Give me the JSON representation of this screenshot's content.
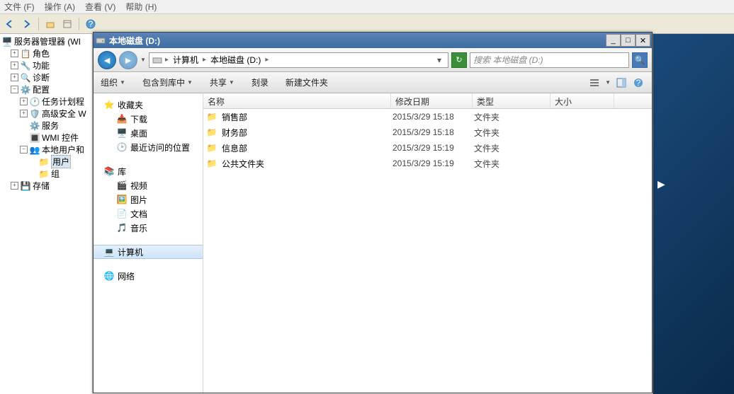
{
  "menubar": {
    "file": "文件 (F)",
    "action": "操作 (A)",
    "view": "查看 (V)",
    "help": "帮助 (H)"
  },
  "tree": {
    "root": "服务器管理器 (WI",
    "roles": "角色",
    "features": "功能",
    "diagnostics": "诊断",
    "config": "配置",
    "tasksched": "任务计划程",
    "advsec": "高级安全 W",
    "services": "服务",
    "wmi": "WMI 控件",
    "localusers": "本地用户和",
    "users": "用户",
    "groups": "组",
    "storage": "存储"
  },
  "window": {
    "title": "本地磁盘 (D:)",
    "breadcrumb": {
      "computer": "计算机",
      "drive": "本地磁盘 (D:)"
    },
    "search_placeholder": "搜索 本地磁盘 (D:)"
  },
  "cmds": {
    "organize": "组织",
    "include": "包含到库中",
    "share": "共享",
    "burn": "刻录",
    "newfolder": "新建文件夹"
  },
  "nav": {
    "favorites": "收藏夹",
    "downloads": "下载",
    "desktop": "桌面",
    "recent": "最近访问的位置",
    "libraries": "库",
    "videos": "视频",
    "pictures": "图片",
    "documents": "文档",
    "music": "音乐",
    "computer": "计算机",
    "network": "网络"
  },
  "cols": {
    "name": "名称",
    "date": "修改日期",
    "type": "类型",
    "size": "大小"
  },
  "files": [
    {
      "name": "销售部",
      "date": "2015/3/29 15:18",
      "type": "文件夹"
    },
    {
      "name": "财务部",
      "date": "2015/3/29 15:18",
      "type": "文件夹"
    },
    {
      "name": "信息部",
      "date": "2015/3/29 15:19",
      "type": "文件夹"
    },
    {
      "name": "公共文件夹",
      "date": "2015/3/29 15:19",
      "type": "文件夹"
    }
  ]
}
